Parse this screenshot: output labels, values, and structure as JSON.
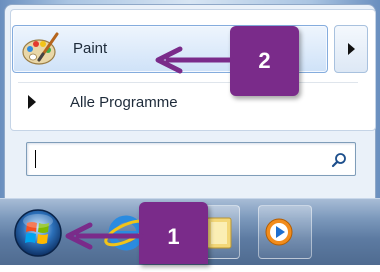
{
  "start_menu": {
    "pinned_items": [
      {
        "label": "Paint",
        "icon": "paint-palette-icon"
      }
    ],
    "jump_list_arrow": "chevron-right-icon",
    "all_programs_label": "Alle Programme",
    "search": {
      "value": "",
      "placeholder": "",
      "icon": "search-icon"
    }
  },
  "taskbar": {
    "start_button": "windows-orb-icon",
    "pinned_apps": [
      "internet-explorer-icon",
      "windows-explorer-icon",
      "windows-media-player-icon"
    ]
  },
  "annotations": [
    {
      "number": "1",
      "target": "start button"
    },
    {
      "number": "2",
      "target": "Paint"
    }
  ],
  "colors": {
    "annotation_fill": "#7a2b8a",
    "taskbar": "#5d7ba2",
    "highlight": "#cfe2f8"
  }
}
